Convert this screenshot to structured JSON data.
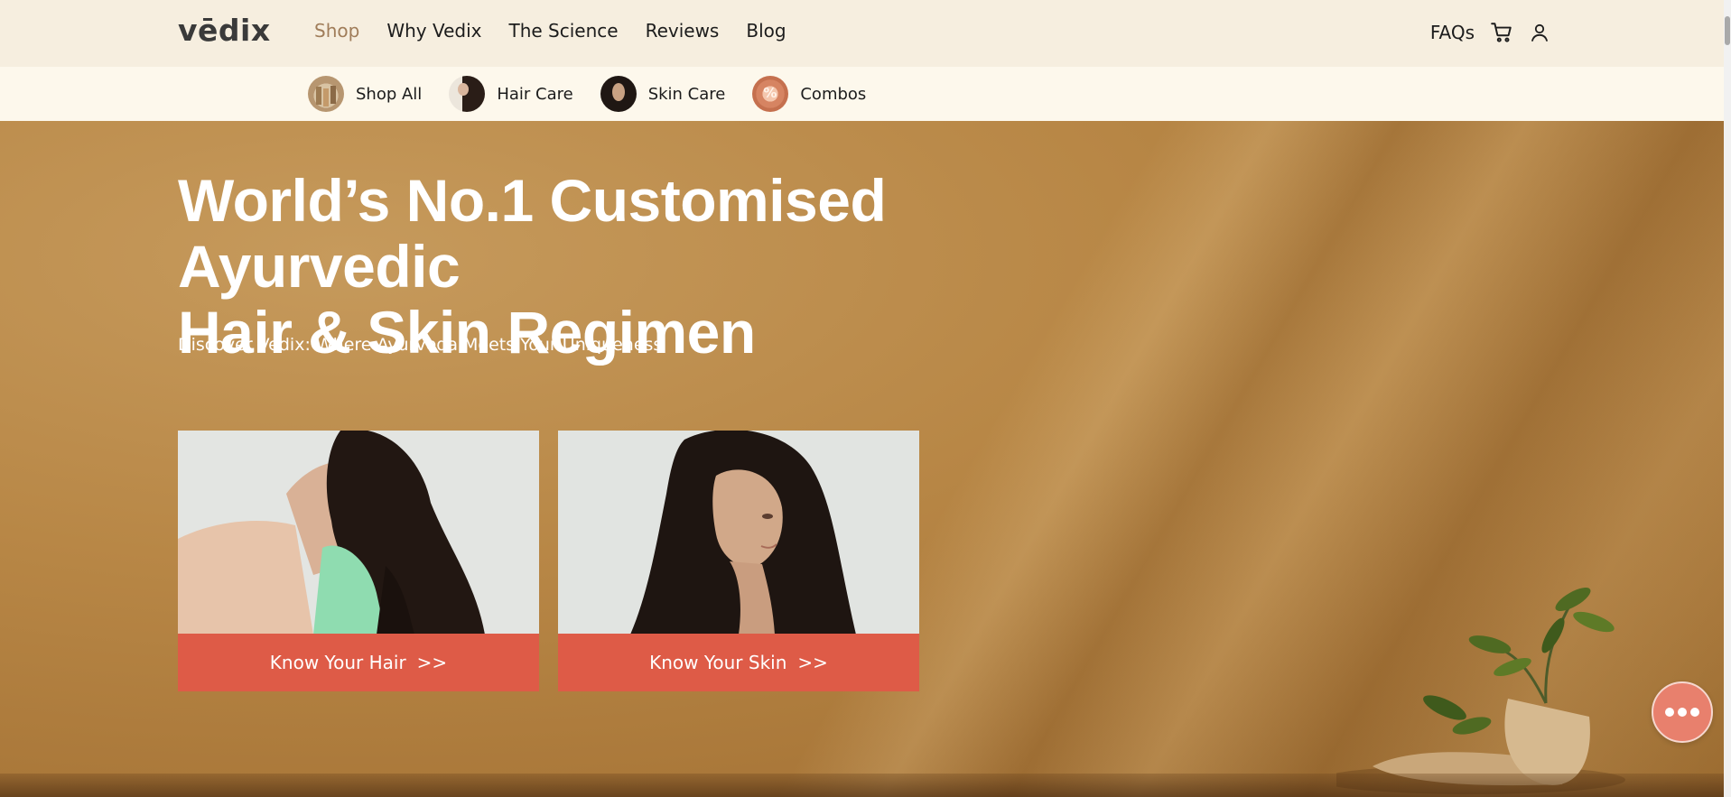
{
  "brand": {
    "logo_text": "vēdix"
  },
  "nav": {
    "links": [
      {
        "label": "Shop",
        "active": true
      },
      {
        "label": "Why Vedix",
        "active": false
      },
      {
        "label": "The Science",
        "active": false
      },
      {
        "label": "Reviews",
        "active": false
      },
      {
        "label": "Blog",
        "active": false
      }
    ],
    "faqs_label": "FAQs",
    "cart_icon": "cart-icon",
    "account_icon": "user-icon"
  },
  "subnav": {
    "items": [
      {
        "label": "Shop All",
        "icon": "products-thumbnail"
      },
      {
        "label": "Hair Care",
        "icon": "hair-care-thumbnail"
      },
      {
        "label": "Skin Care",
        "icon": "skin-care-thumbnail"
      },
      {
        "label": "Combos",
        "icon": "combos-percent-thumbnail"
      }
    ]
  },
  "hero": {
    "title_line1": "World’s No.1 Customised Ayurvedic",
    "title_line2": "Hair & Skin Regimen",
    "subtitle": "Discover Vedix: Where Ayurveda Meets Your Uniqueness",
    "cards": [
      {
        "button_label": "Know Your Hair",
        "chevron": ">>"
      },
      {
        "button_label": "Know Your Skin",
        "chevron": ">>"
      }
    ]
  },
  "chat_fab": {
    "icon": "more-dots-icon"
  },
  "colors": {
    "nav_bg": "#f6eedf",
    "subnav_bg": "#fdf8ec",
    "active_link": "#a07d5a",
    "cta": "#de5b47",
    "fab": "#e8806d"
  }
}
